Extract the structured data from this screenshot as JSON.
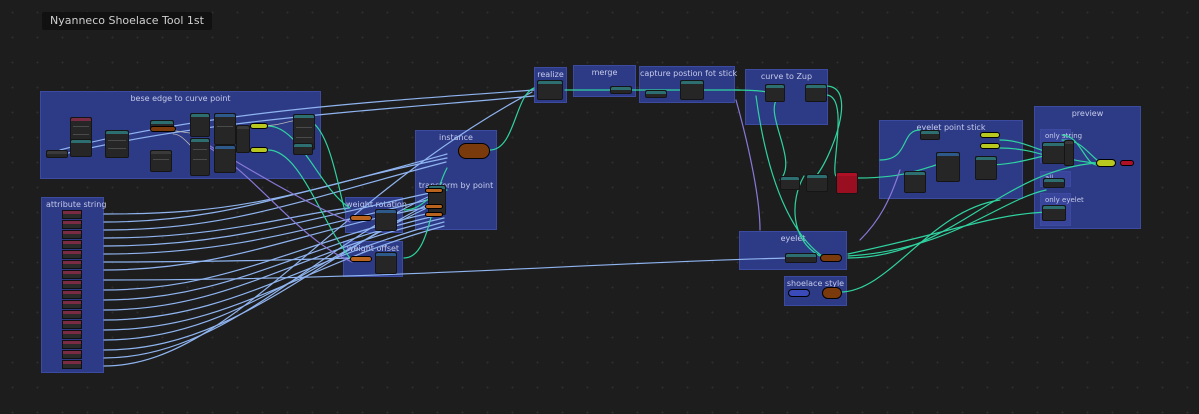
{
  "app": {
    "title": "Nyanneco Shoelace Tool 1st"
  },
  "frames": {
    "bese_edge": "bese edge to curve point",
    "attribute_string": "attribute string",
    "instance": "instance",
    "transform_by_point": "transform by point",
    "weight_rotation": "weight rotation",
    "weight_offset": "weight offset",
    "realize": "realize",
    "merge": "merge",
    "capture": "capture postion fot stick",
    "curve_to_zup": "curve to Zup",
    "eyelet_point_stick": "eyelet point stick",
    "eyelet": "eyelet",
    "shoelace_style": "shoelace style",
    "preview": "preview",
    "only_string": "only string",
    "all": "all",
    "only_eyelet": "only eyelet"
  },
  "colors": {
    "background": "#1d1d1d",
    "frame": "#2d3a86",
    "geometry_link": "#2fd3a0",
    "string_link": "#8fb4f0",
    "vector_link": "#7d6ad6",
    "output_node": "#b8c81e",
    "instance_node": "#7a3a0c",
    "group_output_node": "#b01025"
  },
  "icons": {
    "string_socket": "string-socket-icon",
    "geometry_socket": "geometry-socket-icon"
  }
}
